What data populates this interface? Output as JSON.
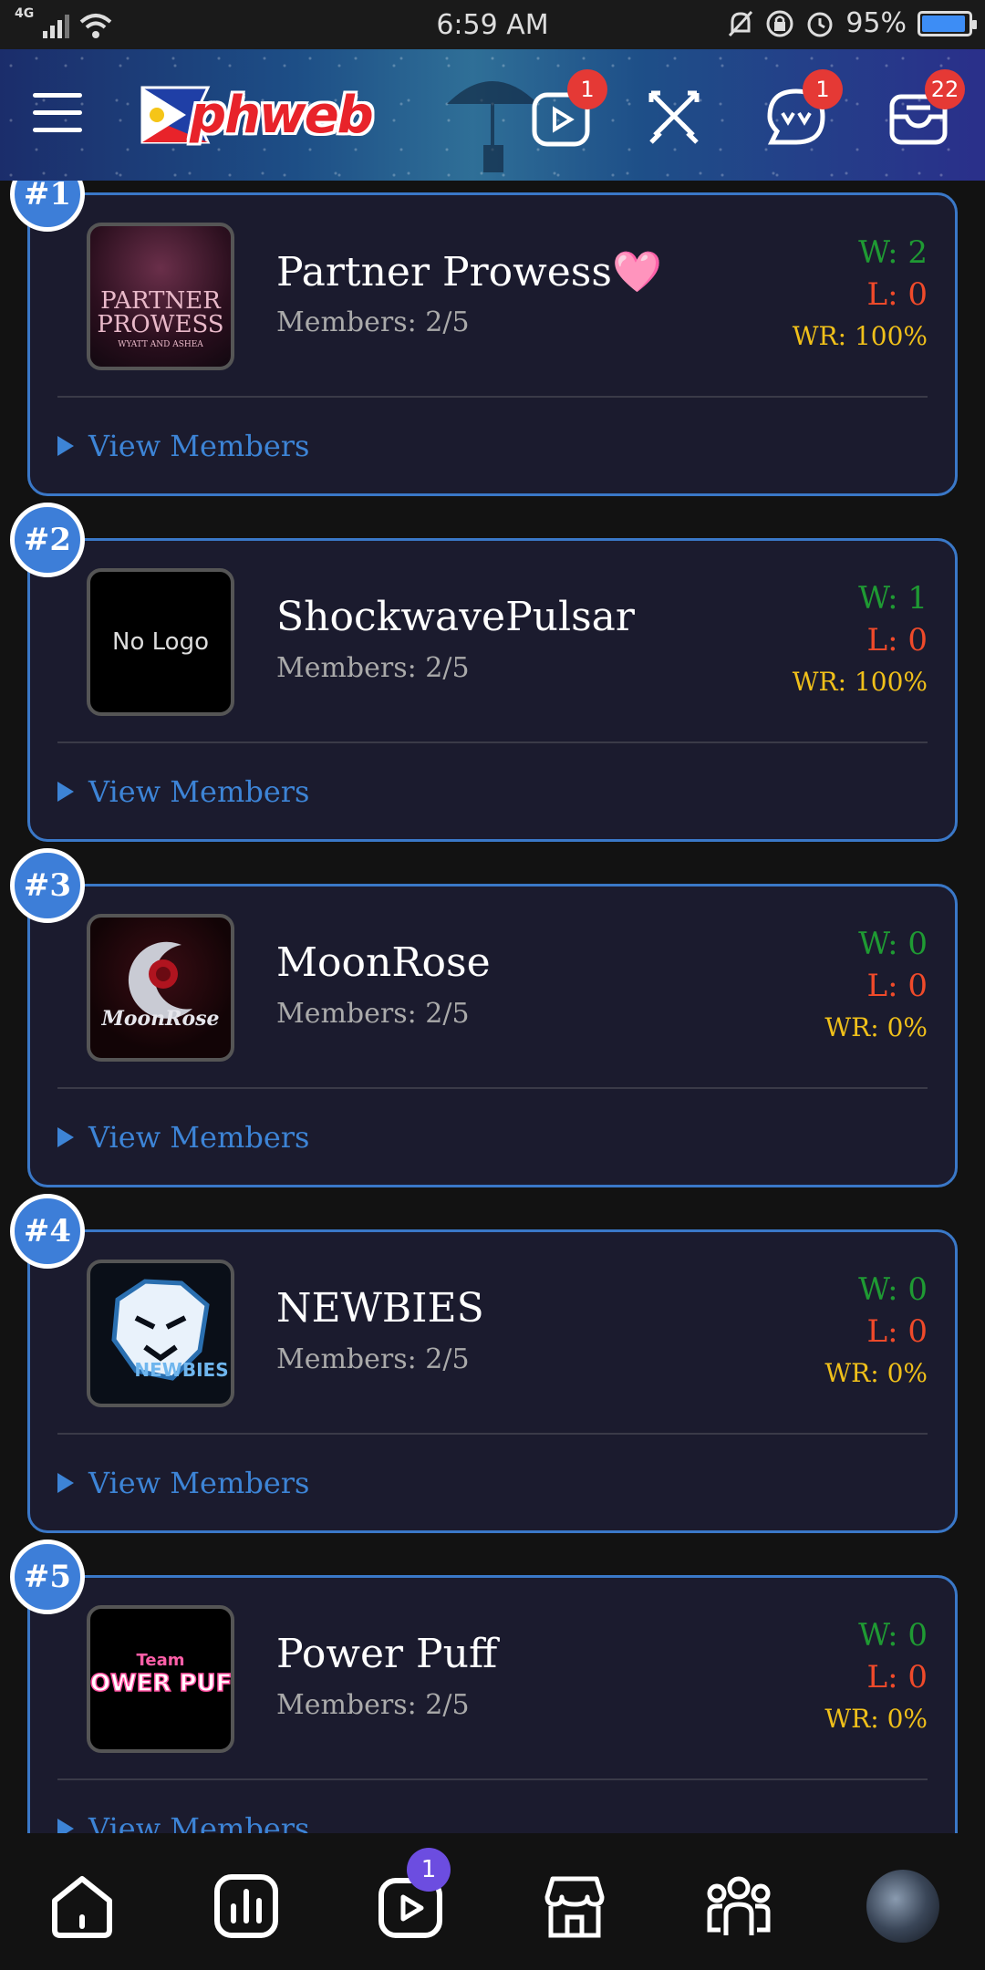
{
  "status_bar": {
    "network": "4G",
    "time": "6:59 AM",
    "battery": "95%",
    "battery_level": 0.95
  },
  "header": {
    "logo_text": "phweb",
    "badges": {
      "videos": "1",
      "chat": "1",
      "inbox": "22"
    }
  },
  "teams": [
    {
      "rank": "#1",
      "name": "Partner Prowess🩷",
      "members": "Members: 2/5",
      "wins": "W: 2",
      "losses": "L: 0",
      "winrate": "WR: 100%",
      "view_label": "View Members",
      "logo_text_1": "PARTNER",
      "logo_text_2": "PROWESS",
      "logo_text_3": "WYATT AND ASHEA"
    },
    {
      "rank": "#2",
      "name": "ShockwavePulsar",
      "members": "Members: 2/5",
      "wins": "W: 1",
      "losses": "L: 0",
      "winrate": "WR: 100%",
      "view_label": "View Members",
      "no_logo": "No Logo"
    },
    {
      "rank": "#3",
      "name": "MoonRose",
      "members": "Members: 2/5",
      "wins": "W: 0",
      "losses": "L: 0",
      "winrate": "WR: 0%",
      "view_label": "View Members",
      "logo_text_1": "MoonRose"
    },
    {
      "rank": "#4",
      "name": "NEWBIES",
      "members": "Members: 2/5",
      "wins": "W: 0",
      "losses": "L: 0",
      "winrate": "WR: 0%",
      "view_label": "View Members",
      "logo_text_1": "NEWBIES"
    },
    {
      "rank": "#5",
      "name": "Power Puff",
      "members": "Members: 2/5",
      "wins": "W: 0",
      "losses": "L: 0",
      "winrate": "WR: 0%",
      "view_label": "View Members",
      "logo_text_1": "Team",
      "logo_text_2": "POWER PUFF"
    }
  ],
  "bottom_nav": {
    "play_badge": "1"
  },
  "colors": {
    "accent": "#3a78c8",
    "win": "#1f9a33",
    "loss": "#f04a2a",
    "winrate": "#f0c01a",
    "badge_red": "#e53935",
    "badge_purple": "#6c4de0"
  }
}
